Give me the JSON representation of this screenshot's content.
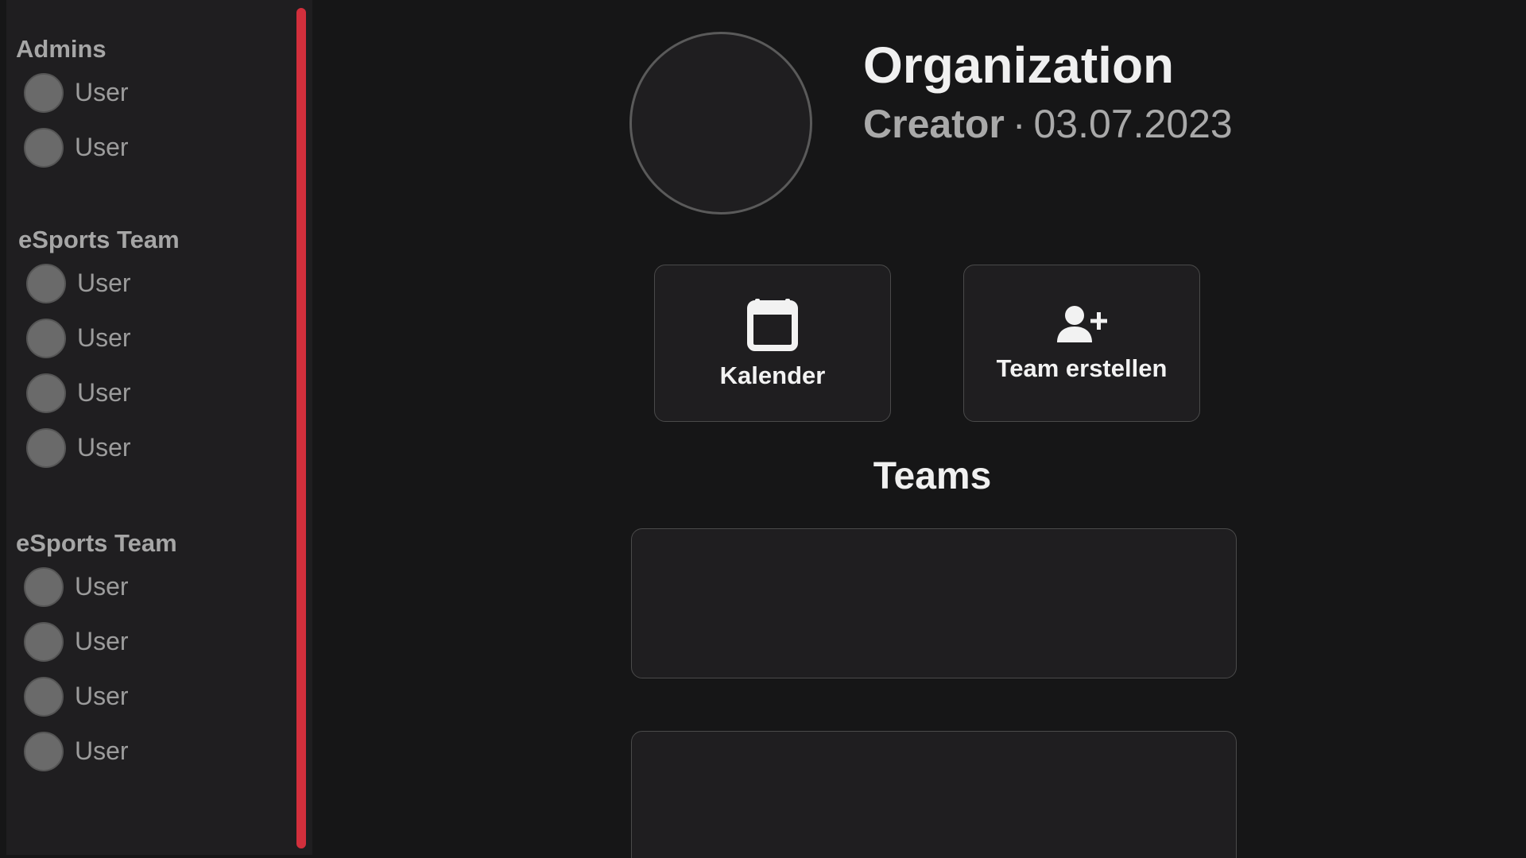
{
  "sidebar": {
    "groups": [
      {
        "title": "Admins",
        "members": [
          "User",
          "User"
        ]
      },
      {
        "title": "eSports Team",
        "members": [
          "User",
          "User",
          "User",
          "User"
        ]
      },
      {
        "title": "eSports Team",
        "members": [
          "User",
          "User",
          "User",
          "User"
        ]
      }
    ],
    "scrollbar_color": "#d12f3c"
  },
  "organization": {
    "name": "Organization",
    "role": "Creator",
    "separator": "·",
    "date": "03.07.2023"
  },
  "actions": {
    "calendar": {
      "label": "Kalender",
      "icon": "calendar-icon"
    },
    "create_team": {
      "label": "Team erstellen",
      "icon": "add-user-icon"
    }
  },
  "teams": {
    "heading": "Teams"
  }
}
